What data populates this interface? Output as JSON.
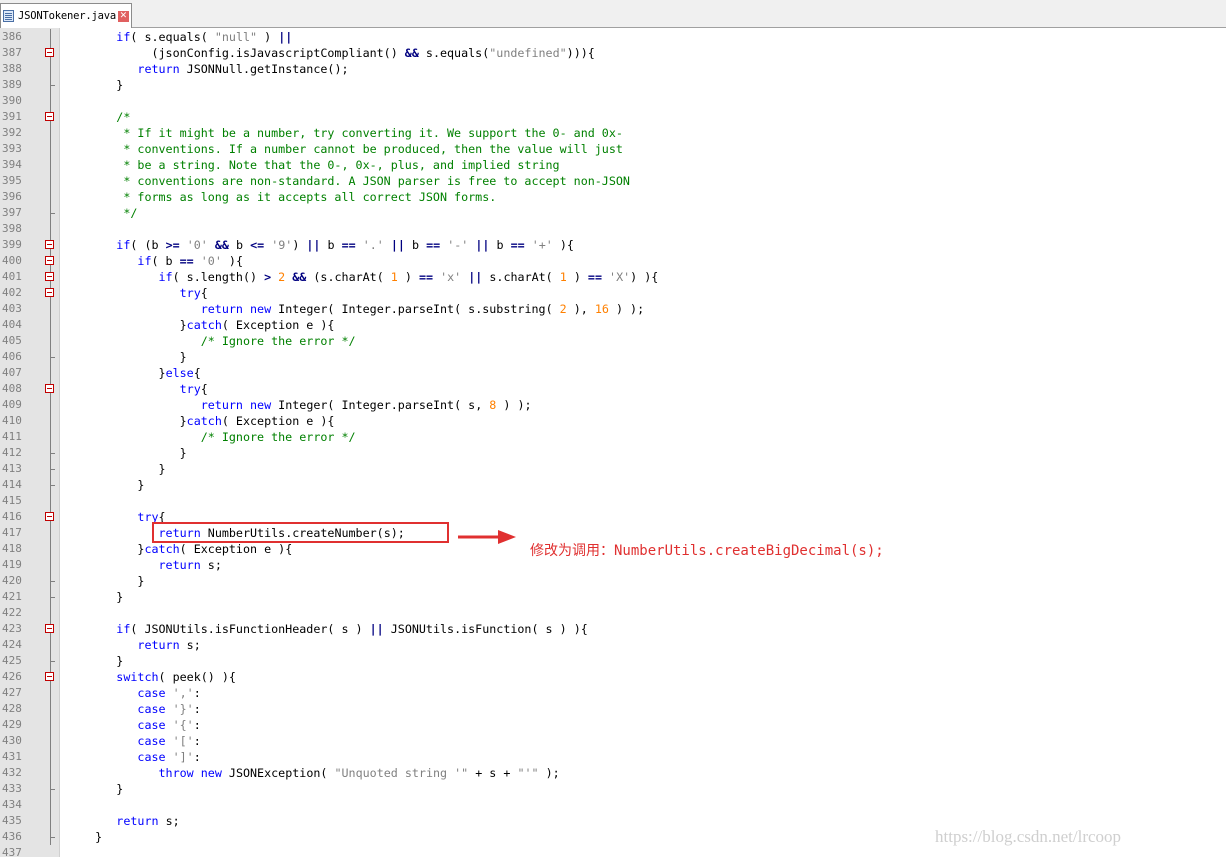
{
  "tab": {
    "label": "JSONTokener.java",
    "close": "✕"
  },
  "lines": [
    {
      "num": "386",
      "fold": "line",
      "tokens": [
        [
          "        ",
          ""
        ],
        [
          "if",
          "kw"
        ],
        [
          "( s.equals( ",
          ""
        ],
        [
          "\"null\"",
          "st"
        ],
        [
          " ) ",
          ""
        ],
        [
          "||",
          "op"
        ]
      ]
    },
    {
      "num": "387",
      "fold": "box",
      "tokens": [
        [
          "             (jsonConfig.isJavascriptCompliant() ",
          ""
        ],
        [
          "&&",
          "op"
        ],
        [
          " s.equals(",
          ""
        ],
        [
          "\"undefined\"",
          "st"
        ],
        [
          "))){",
          ""
        ]
      ]
    },
    {
      "num": "388",
      "fold": "line",
      "tokens": [
        [
          "           ",
          ""
        ],
        [
          "return",
          "kw"
        ],
        [
          " JSONNull.getInstance();",
          ""
        ]
      ]
    },
    {
      "num": "389",
      "fold": "end",
      "tokens": [
        [
          "        }",
          ""
        ]
      ]
    },
    {
      "num": "390",
      "fold": "line",
      "tokens": []
    },
    {
      "num": "391",
      "fold": "box",
      "tokens": [
        [
          "        /*",
          "cm"
        ]
      ]
    },
    {
      "num": "392",
      "fold": "line",
      "tokens": [
        [
          "         * If it might be a number, try converting it. We support the 0- and 0x-",
          "cm"
        ]
      ]
    },
    {
      "num": "393",
      "fold": "line",
      "tokens": [
        [
          "         * conventions. If a number cannot be produced, then the value will just",
          "cm"
        ]
      ]
    },
    {
      "num": "394",
      "fold": "line",
      "tokens": [
        [
          "         * be a string. Note that the 0-, 0x-, plus, and implied string",
          "cm"
        ]
      ]
    },
    {
      "num": "395",
      "fold": "line",
      "tokens": [
        [
          "         * conventions are non-standard. A JSON parser is free to accept non-JSON",
          "cm"
        ]
      ]
    },
    {
      "num": "396",
      "fold": "line",
      "tokens": [
        [
          "         * forms as long as it accepts all correct JSON forms.",
          "cm"
        ]
      ]
    },
    {
      "num": "397",
      "fold": "end",
      "tokens": [
        [
          "         */",
          "cm"
        ]
      ]
    },
    {
      "num": "398",
      "fold": "line",
      "tokens": []
    },
    {
      "num": "399",
      "fold": "box",
      "tokens": [
        [
          "        ",
          ""
        ],
        [
          "if",
          "kw"
        ],
        [
          "( (b ",
          ""
        ],
        [
          ">=",
          "op"
        ],
        [
          " ",
          ""
        ],
        [
          "'0'",
          "st"
        ],
        [
          " ",
          ""
        ],
        [
          "&&",
          "op"
        ],
        [
          " b ",
          ""
        ],
        [
          "<=",
          "op"
        ],
        [
          " ",
          ""
        ],
        [
          "'9'",
          "st"
        ],
        [
          ") ",
          ""
        ],
        [
          "||",
          "op"
        ],
        [
          " b ",
          ""
        ],
        [
          "==",
          "op"
        ],
        [
          " ",
          ""
        ],
        [
          "'.'",
          "st"
        ],
        [
          " ",
          ""
        ],
        [
          "||",
          "op"
        ],
        [
          " b ",
          ""
        ],
        [
          "==",
          "op"
        ],
        [
          " ",
          ""
        ],
        [
          "'-'",
          "st"
        ],
        [
          " ",
          ""
        ],
        [
          "||",
          "op"
        ],
        [
          " b ",
          ""
        ],
        [
          "==",
          "op"
        ],
        [
          " ",
          ""
        ],
        [
          "'+'",
          "st"
        ],
        [
          " ){",
          ""
        ]
      ]
    },
    {
      "num": "400",
      "fold": "box",
      "tokens": [
        [
          "           ",
          ""
        ],
        [
          "if",
          "kw"
        ],
        [
          "( b ",
          ""
        ],
        [
          "==",
          "op"
        ],
        [
          " ",
          ""
        ],
        [
          "'0'",
          "st"
        ],
        [
          " ){",
          ""
        ]
      ]
    },
    {
      "num": "401",
      "fold": "box",
      "tokens": [
        [
          "              ",
          ""
        ],
        [
          "if",
          "kw"
        ],
        [
          "( s.length() ",
          ""
        ],
        [
          ">",
          "op"
        ],
        [
          " ",
          ""
        ],
        [
          "2",
          "nm"
        ],
        [
          " ",
          ""
        ],
        [
          "&&",
          "op"
        ],
        [
          " (s.charAt( ",
          ""
        ],
        [
          "1",
          "nm"
        ],
        [
          " ) ",
          ""
        ],
        [
          "==",
          "op"
        ],
        [
          " ",
          ""
        ],
        [
          "'x'",
          "st"
        ],
        [
          " ",
          ""
        ],
        [
          "||",
          "op"
        ],
        [
          " s.charAt( ",
          ""
        ],
        [
          "1",
          "nm"
        ],
        [
          " ) ",
          ""
        ],
        [
          "==",
          "op"
        ],
        [
          " ",
          ""
        ],
        [
          "'X'",
          "st"
        ],
        [
          ") ){",
          ""
        ]
      ]
    },
    {
      "num": "402",
      "fold": "box",
      "tokens": [
        [
          "                 ",
          ""
        ],
        [
          "try",
          "kw"
        ],
        [
          "{",
          ""
        ]
      ]
    },
    {
      "num": "403",
      "fold": "line",
      "tokens": [
        [
          "                    ",
          ""
        ],
        [
          "return",
          "kw"
        ],
        [
          " ",
          ""
        ],
        [
          "new",
          "kw"
        ],
        [
          " Integer( Integer.parseInt( s.substring( ",
          ""
        ],
        [
          "2",
          "nm"
        ],
        [
          " ), ",
          ""
        ],
        [
          "16",
          "nm"
        ],
        [
          " ) );",
          ""
        ]
      ]
    },
    {
      "num": "404",
      "fold": "line",
      "tokens": [
        [
          "                 }",
          ""
        ],
        [
          "catch",
          "kw"
        ],
        [
          "( Exception e ){",
          ""
        ]
      ]
    },
    {
      "num": "405",
      "fold": "line",
      "tokens": [
        [
          "                    /* Ignore the error */",
          "cm"
        ]
      ]
    },
    {
      "num": "406",
      "fold": "end",
      "tokens": [
        [
          "                 }",
          ""
        ]
      ]
    },
    {
      "num": "407",
      "fold": "line",
      "tokens": [
        [
          "              }",
          ""
        ],
        [
          "else",
          "kw"
        ],
        [
          "{",
          ""
        ]
      ]
    },
    {
      "num": "408",
      "fold": "box",
      "tokens": [
        [
          "                 ",
          ""
        ],
        [
          "try",
          "kw"
        ],
        [
          "{",
          ""
        ]
      ]
    },
    {
      "num": "409",
      "fold": "line",
      "tokens": [
        [
          "                    ",
          ""
        ],
        [
          "return",
          "kw"
        ],
        [
          " ",
          ""
        ],
        [
          "new",
          "kw"
        ],
        [
          " Integer( Integer.parseInt( s, ",
          ""
        ],
        [
          "8",
          "nm"
        ],
        [
          " ) );",
          ""
        ]
      ]
    },
    {
      "num": "410",
      "fold": "line",
      "tokens": [
        [
          "                 }",
          ""
        ],
        [
          "catch",
          "kw"
        ],
        [
          "( Exception e ){",
          ""
        ]
      ]
    },
    {
      "num": "411",
      "fold": "line",
      "tokens": [
        [
          "                    /* Ignore the error */",
          "cm"
        ]
      ]
    },
    {
      "num": "412",
      "fold": "end",
      "tokens": [
        [
          "                 }",
          ""
        ]
      ]
    },
    {
      "num": "413",
      "fold": "end",
      "tokens": [
        [
          "              }",
          ""
        ]
      ]
    },
    {
      "num": "414",
      "fold": "end",
      "tokens": [
        [
          "           }",
          ""
        ]
      ]
    },
    {
      "num": "415",
      "fold": "line",
      "tokens": []
    },
    {
      "num": "416",
      "fold": "box",
      "tokens": [
        [
          "           ",
          ""
        ],
        [
          "try",
          "kw"
        ],
        [
          "{",
          ""
        ]
      ]
    },
    {
      "num": "417",
      "fold": "line",
      "tokens": [
        [
          "              ",
          ""
        ],
        [
          "return",
          "kw"
        ],
        [
          " NumberUtils.createNumber(s);",
          ""
        ]
      ]
    },
    {
      "num": "418",
      "fold": "line",
      "tokens": [
        [
          "           }",
          ""
        ],
        [
          "catch",
          "kw"
        ],
        [
          "( Exception e ){",
          ""
        ]
      ]
    },
    {
      "num": "419",
      "fold": "line",
      "tokens": [
        [
          "              ",
          ""
        ],
        [
          "return",
          "kw"
        ],
        [
          " s;",
          ""
        ]
      ]
    },
    {
      "num": "420",
      "fold": "end",
      "tokens": [
        [
          "           }",
          ""
        ]
      ]
    },
    {
      "num": "421",
      "fold": "end",
      "tokens": [
        [
          "        }",
          ""
        ]
      ]
    },
    {
      "num": "422",
      "fold": "line",
      "tokens": []
    },
    {
      "num": "423",
      "fold": "box",
      "tokens": [
        [
          "        ",
          ""
        ],
        [
          "if",
          "kw"
        ],
        [
          "( JSONUtils.isFunctionHeader( s ) ",
          ""
        ],
        [
          "||",
          "op"
        ],
        [
          " JSONUtils.isFunction( s ) ){",
          ""
        ]
      ]
    },
    {
      "num": "424",
      "fold": "line",
      "tokens": [
        [
          "           ",
          ""
        ],
        [
          "return",
          "kw"
        ],
        [
          " s;",
          ""
        ]
      ]
    },
    {
      "num": "425",
      "fold": "end",
      "tokens": [
        [
          "        }",
          ""
        ]
      ]
    },
    {
      "num": "426",
      "fold": "box",
      "tokens": [
        [
          "        ",
          ""
        ],
        [
          "switch",
          "kw"
        ],
        [
          "( peek() ){",
          ""
        ]
      ]
    },
    {
      "num": "427",
      "fold": "line",
      "tokens": [
        [
          "           ",
          ""
        ],
        [
          "case",
          "kw"
        ],
        [
          " ",
          ""
        ],
        [
          "','",
          "st"
        ],
        [
          ":",
          ""
        ]
      ]
    },
    {
      "num": "428",
      "fold": "line",
      "tokens": [
        [
          "           ",
          ""
        ],
        [
          "case",
          "kw"
        ],
        [
          " ",
          ""
        ],
        [
          "'}'",
          "st"
        ],
        [
          ":",
          ""
        ]
      ]
    },
    {
      "num": "429",
      "fold": "line",
      "tokens": [
        [
          "           ",
          ""
        ],
        [
          "case",
          "kw"
        ],
        [
          " ",
          ""
        ],
        [
          "'{'",
          "st"
        ],
        [
          ":",
          ""
        ]
      ]
    },
    {
      "num": "430",
      "fold": "line",
      "tokens": [
        [
          "           ",
          ""
        ],
        [
          "case",
          "kw"
        ],
        [
          " ",
          ""
        ],
        [
          "'['",
          "st"
        ],
        [
          ":",
          ""
        ]
      ]
    },
    {
      "num": "431",
      "fold": "line",
      "tokens": [
        [
          "           ",
          ""
        ],
        [
          "case",
          "kw"
        ],
        [
          " ",
          ""
        ],
        [
          "']'",
          "st"
        ],
        [
          ":",
          ""
        ]
      ]
    },
    {
      "num": "432",
      "fold": "line",
      "tokens": [
        [
          "              ",
          ""
        ],
        [
          "throw",
          "kw"
        ],
        [
          " ",
          ""
        ],
        [
          "new",
          "kw"
        ],
        [
          " JSONException( ",
          ""
        ],
        [
          "\"Unquoted string '\"",
          "st"
        ],
        [
          " + s + ",
          ""
        ],
        [
          "\"'\"",
          "st"
        ],
        [
          " );",
          ""
        ]
      ]
    },
    {
      "num": "433",
      "fold": "end",
      "tokens": [
        [
          "        }",
          ""
        ]
      ]
    },
    {
      "num": "434",
      "fold": "line",
      "tokens": []
    },
    {
      "num": "435",
      "fold": "line",
      "tokens": [
        [
          "        ",
          ""
        ],
        [
          "return",
          "kw"
        ],
        [
          " s;",
          ""
        ]
      ]
    },
    {
      "num": "436",
      "fold": "end",
      "tokens": [
        [
          "     }",
          ""
        ]
      ]
    },
    {
      "num": "437",
      "fold": "none",
      "tokens": []
    }
  ],
  "annotation": "修改为调用：NumberUtils.createBigDecimal(s);",
  "watermark": "https://blog.csdn.net/lrcoop",
  "colors": {
    "highlight": "#e03030",
    "keyword": "#0000ff",
    "comment": "#008000",
    "string": "#808080",
    "number": "#ff8000"
  }
}
